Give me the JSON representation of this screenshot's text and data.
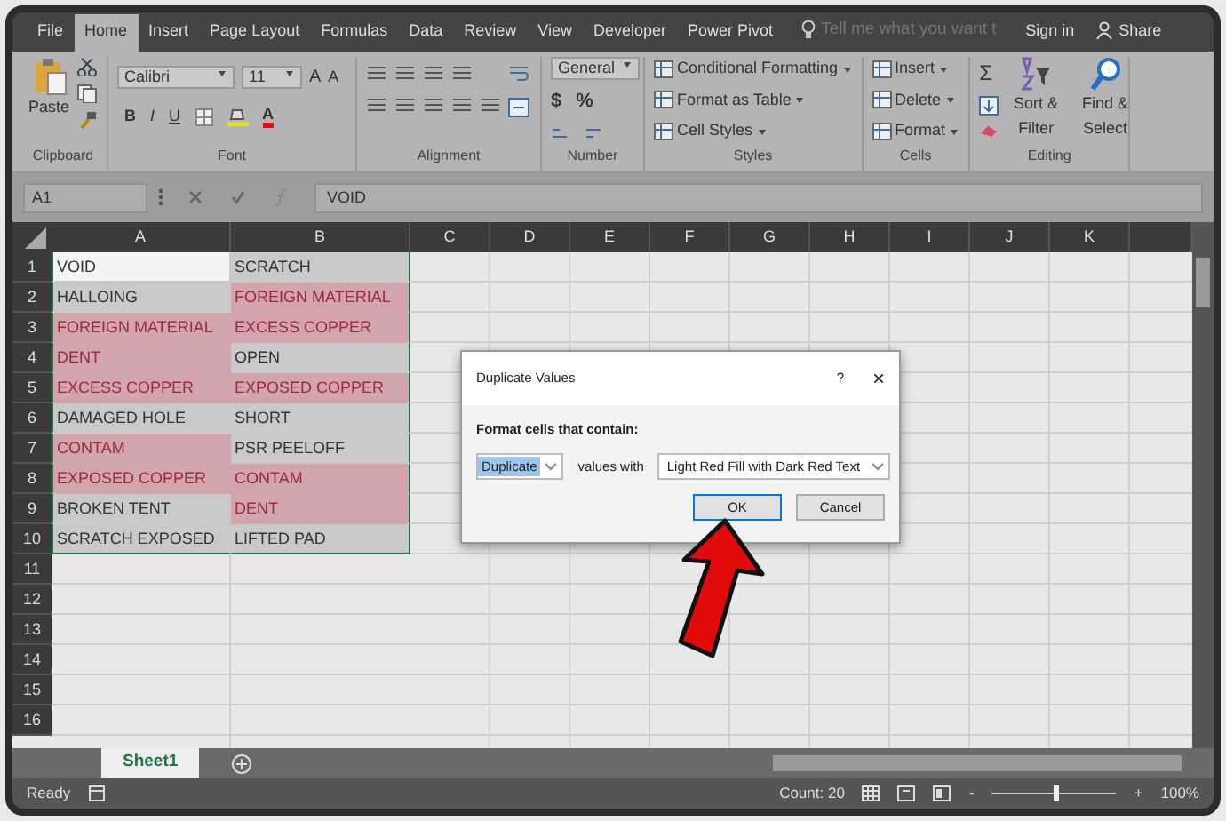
{
  "tabs": [
    {
      "label": "File",
      "selected": false
    },
    {
      "label": "Home",
      "selected": true
    },
    {
      "label": "Insert",
      "selected": false
    },
    {
      "label": "Page Layout",
      "selected": false
    },
    {
      "label": "Formulas",
      "selected": false
    },
    {
      "label": "Data",
      "selected": false
    },
    {
      "label": "Review",
      "selected": false
    },
    {
      "label": "View",
      "selected": false
    },
    {
      "label": "Developer",
      "selected": false
    },
    {
      "label": "Power Pivot",
      "selected": false
    }
  ],
  "tell_me": {
    "placeholder": "Tell me what you want t"
  },
  "sign_in": "Sign in",
  "share": "Share",
  "ribbon": {
    "groups": [
      {
        "kind": "clipboard",
        "label": "Clipboard",
        "paste": "Paste"
      },
      {
        "kind": "font",
        "label": "Font",
        "font_name": "Calibri",
        "font_size": "11",
        "grow": "A",
        "shrink": "A",
        "bold": "B",
        "italic": "I",
        "underline": "U",
        "font_color": "A"
      },
      {
        "kind": "alignment",
        "label": "Alignment"
      },
      {
        "kind": "number",
        "label": "Number",
        "format": "General",
        "currency": "$",
        "percent": "%"
      },
      {
        "kind": "list",
        "label": "Styles",
        "items": [
          "Conditional Formatting",
          "Format as Table",
          "Cell Styles"
        ]
      },
      {
        "kind": "list",
        "label": "Cells",
        "items": [
          "Insert",
          "Delete",
          "Format"
        ]
      },
      {
        "kind": "editing",
        "label": "Editing",
        "sum": "Σ",
        "sort": "Sort & Filter",
        "find": "Find & Select"
      }
    ]
  },
  "name_box": "A1",
  "formula": "VOID",
  "columns": [
    "A",
    "B",
    "C",
    "D",
    "E",
    "F",
    "G",
    "H",
    "I",
    "J",
    "K"
  ],
  "rows": [
    {
      "number": "1",
      "cells": [
        {
          "text": "VOID",
          "duplicate": false,
          "active": true
        },
        {
          "text": "SCRATCH",
          "duplicate": false,
          "active": false
        }
      ]
    },
    {
      "number": "2",
      "cells": [
        {
          "text": "HALLOING",
          "duplicate": false,
          "active": false
        },
        {
          "text": "FOREIGN MATERIAL",
          "duplicate": true,
          "active": false
        }
      ]
    },
    {
      "number": "3",
      "cells": [
        {
          "text": "FOREIGN MATERIAL",
          "duplicate": true,
          "active": false
        },
        {
          "text": "EXCESS COPPER",
          "duplicate": true,
          "active": false
        }
      ]
    },
    {
      "number": "4",
      "cells": [
        {
          "text": "DENT",
          "duplicate": true,
          "active": false
        },
        {
          "text": "OPEN",
          "duplicate": false,
          "active": false
        }
      ]
    },
    {
      "number": "5",
      "cells": [
        {
          "text": "EXCESS COPPER",
          "duplicate": true,
          "active": false
        },
        {
          "text": "EXPOSED COPPER",
          "duplicate": true,
          "active": false
        }
      ]
    },
    {
      "number": "6",
      "cells": [
        {
          "text": "DAMAGED HOLE",
          "duplicate": false,
          "active": false
        },
        {
          "text": "SHORT",
          "duplicate": false,
          "active": false
        }
      ]
    },
    {
      "number": "7",
      "cells": [
        {
          "text": "CONTAM",
          "duplicate": true,
          "active": false
        },
        {
          "text": "PSR PEELOFF",
          "duplicate": false,
          "active": false
        }
      ]
    },
    {
      "number": "8",
      "cells": [
        {
          "text": "EXPOSED COPPER",
          "duplicate": true,
          "active": false
        },
        {
          "text": "CONTAM",
          "duplicate": true,
          "active": false
        }
      ]
    },
    {
      "number": "9",
      "cells": [
        {
          "text": "BROKEN TENT",
          "duplicate": false,
          "active": false
        },
        {
          "text": "DENT",
          "duplicate": true,
          "active": false
        }
      ]
    },
    {
      "number": "10",
      "cells": [
        {
          "text": "SCRATCH EXPOSED",
          "duplicate": false,
          "active": false
        },
        {
          "text": "LIFTED PAD",
          "duplicate": false,
          "active": false
        }
      ]
    },
    {
      "number": "11",
      "cells": []
    },
    {
      "number": "12",
      "cells": []
    },
    {
      "number": "13",
      "cells": []
    },
    {
      "number": "14",
      "cells": []
    },
    {
      "number": "15",
      "cells": []
    },
    {
      "number": "16",
      "cells": []
    }
  ],
  "dialog": {
    "title": "Duplicate Values",
    "help": "?",
    "close": "×",
    "prompt": "Format cells that contain:",
    "rule": "Duplicate",
    "connector": "values with",
    "format": "Light Red Fill with Dark Red Text",
    "buttons": [
      {
        "label": "OK",
        "default": true
      },
      {
        "label": "Cancel",
        "default": false
      }
    ]
  },
  "sheets": [
    {
      "label": "Sheet1",
      "selected": true
    }
  ],
  "status": {
    "mode": "Ready",
    "count": "Count: 20",
    "zoom_out": "-",
    "zoom_in": "+",
    "zoom": {
      "level": 0.5
    },
    "zoom_text": "100%"
  }
}
